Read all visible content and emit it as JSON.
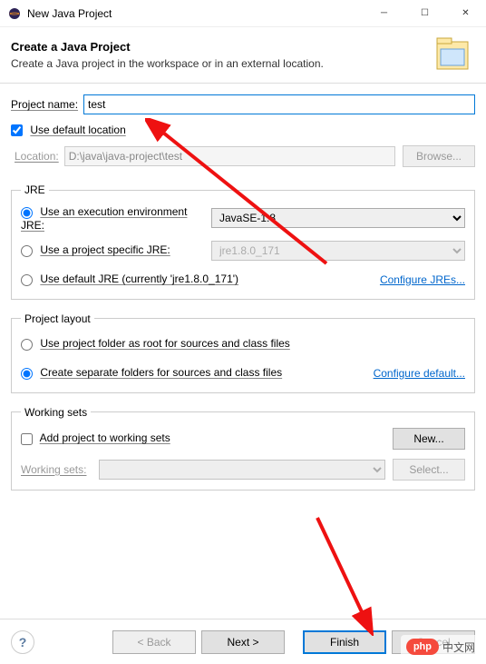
{
  "window": {
    "title": "New Java Project"
  },
  "banner": {
    "title": "Create a Java Project",
    "subtitle": "Create a Java project in the workspace or in an external location."
  },
  "project": {
    "name_label": "Project name:",
    "name_value": "test",
    "use_default_label": "Use default location",
    "location_label": "Location:",
    "location_value": "D:\\java\\java-project\\test",
    "browse_btn": "Browse..."
  },
  "jre": {
    "legend": "JRE",
    "exec_env_label": "Use an execution environment JRE:",
    "exec_env_value": "JavaSE-1.8",
    "specific_label": "Use a project specific JRE:",
    "specific_value": "jre1.8.0_171",
    "default_label": "Use default JRE (currently 'jre1.8.0_171')",
    "configure_link": "Configure JREs..."
  },
  "layout": {
    "legend": "Project layout",
    "root_label": "Use project folder as root for sources and class files",
    "separate_label": "Create separate folders for sources and class files",
    "configure_link": "Configure default..."
  },
  "working": {
    "legend": "Working sets",
    "add_label": "Add project to working sets",
    "new_btn": "New...",
    "sets_label": "Working sets:",
    "select_btn": "Select..."
  },
  "buttons": {
    "back": "< Back",
    "next": "Next >",
    "finish": "Finish",
    "cancel": "Cancel"
  },
  "logo": {
    "php": "php",
    "cn": "中文网"
  }
}
